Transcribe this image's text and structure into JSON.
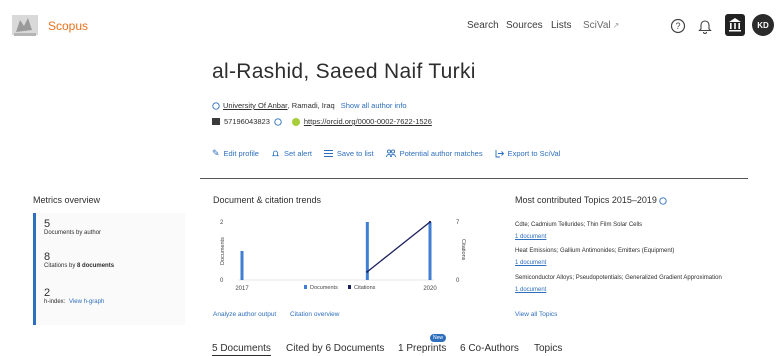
{
  "header": {
    "logo_text": "Scopus",
    "nav": {
      "search": "Search",
      "sources": "Sources",
      "lists": "Lists",
      "scival": "SciVal",
      "scival_ext": "↗"
    },
    "avatar_initials": "KD",
    "icons": [
      "elsevier-logo-icon",
      "help-icon",
      "bell-icon",
      "institution-icon"
    ]
  },
  "author": {
    "name": "al-Rashid, Saeed Naif Turki",
    "affiliation": "University Of Anbar",
    "location": ", Ramadi, Iraq",
    "show_all": "Show all author info",
    "scopus_id": "57196043823",
    "orcid": "https://orcid.org/0000-0002-7622-1526"
  },
  "actions": {
    "edit": "Edit profile",
    "alert": "Set alert",
    "save": "Save to list",
    "matches": "Potential author matches",
    "export": "Export to SciVal"
  },
  "metrics": {
    "title": "Metrics overview",
    "documents_num": "5",
    "documents_label": "Documents by author",
    "citations_num": "8",
    "citations_label": "Citations by",
    "citations_count": "8",
    "citations_suffix": "documents",
    "hindex_num": "2",
    "hindex_label": "h-index:",
    "hgraph": "View h-graph"
  },
  "chart": {
    "title": "Document & citation trends",
    "y_left_label": "Documents",
    "y_right_label": "Citations",
    "legend_documents": "Documents",
    "legend_citations": "Citations",
    "analyze_link": "Analyze author output",
    "overview_link": "Citation overview",
    "colors": {
      "documents": "#3f7fd3",
      "citations": "#1a1f5e"
    }
  },
  "chart_data": {
    "type": "bar",
    "x_ticks": [
      "2017",
      "2020"
    ],
    "x_range": [
      2017,
      2020
    ],
    "series": [
      {
        "name": "Documents",
        "type": "bar",
        "x": [
          2017,
          2019,
          2020
        ],
        "values": [
          1,
          2,
          2
        ]
      },
      {
        "name": "Citations",
        "type": "line",
        "x": [
          2019,
          2020
        ],
        "values": [
          1,
          7
        ]
      }
    ],
    "y_left_ticks": [
      "0",
      "2"
    ],
    "y_left_range": [
      0,
      2
    ],
    "y_right_ticks": [
      "0",
      "7"
    ],
    "y_right_range": [
      0,
      7
    ],
    "legend": "bottom"
  },
  "topics": {
    "title": "Most contributed Topics 2015–2019",
    "items": [
      {
        "name": "Cdte; Cadmium Tellurides; Thin Film Solar Cells",
        "doc": "1 document"
      },
      {
        "name": "Heat Emissions; Gallium Antimonides; Emitters (Equipment)",
        "doc": "1 document"
      },
      {
        "name": "Semiconductor Alloys; Pseudopotentials; Generalized Gradient Approximation",
        "doc": "1 document"
      }
    ],
    "view_all": "View all Topics"
  },
  "tabs": {
    "documents": "5 Documents",
    "cited_by": "Cited by 6 Documents",
    "preprints": "1 Preprints",
    "new_badge": "New",
    "coauthors": "6 Co-Authors",
    "topics": "Topics"
  }
}
